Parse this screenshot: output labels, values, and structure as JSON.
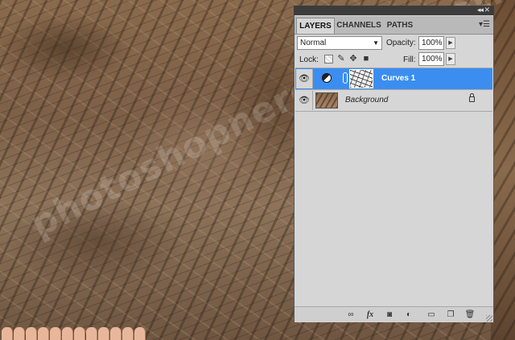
{
  "watermark": "photoshopnerd.blogspot.com",
  "panel": {
    "collapse_label": "◂◂",
    "close_label": "✕",
    "tabs": [
      {
        "label": "LAYERS",
        "active": true
      },
      {
        "label": "CHANNELS",
        "active": false
      },
      {
        "label": "PATHS",
        "active": false
      }
    ],
    "menu_icon": "panel-menu-icon",
    "blend_mode": "Normal",
    "opacity_label": "Opacity:",
    "opacity_value": "100%",
    "lock_label": "Lock:",
    "fill_label": "Fill:",
    "fill_value": "100%",
    "lock_icons": [
      "lock-transparent-icon",
      "lock-paint-icon",
      "lock-move-icon",
      "lock-all-icon"
    ],
    "layers": [
      {
        "name": "Curves 1",
        "type": "adjustment",
        "selected": true,
        "visible": true
      },
      {
        "name": "Background",
        "type": "image",
        "selected": false,
        "visible": true,
        "locked": true
      }
    ],
    "bottom_icons": [
      "link-layers-icon",
      "fx-icon",
      "add-mask-icon",
      "adjustment-layer-icon",
      "new-group-icon",
      "new-layer-icon",
      "delete-layer-icon"
    ]
  }
}
